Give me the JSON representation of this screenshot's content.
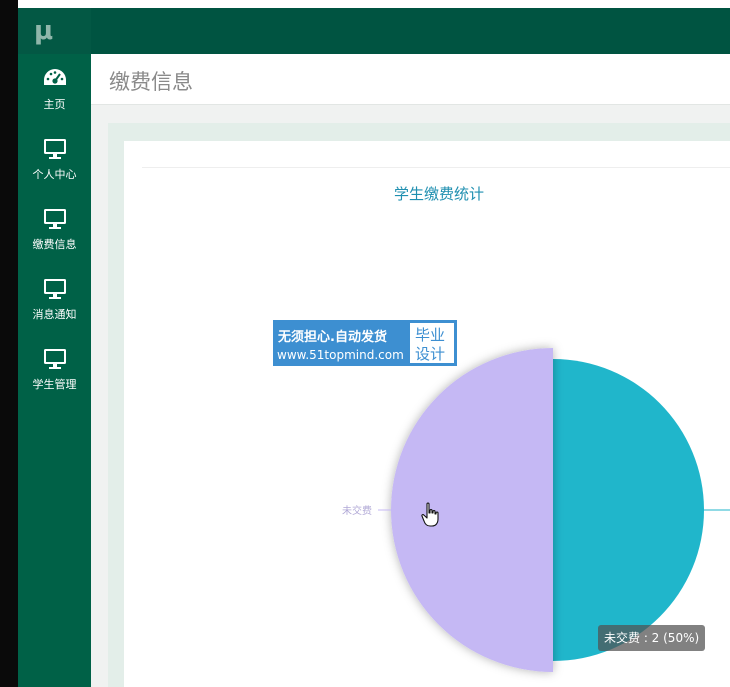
{
  "sidebar": {
    "logo": "μ",
    "items": [
      {
        "label": "主页",
        "icon": "dashboard-icon"
      },
      {
        "label": "个人中心",
        "icon": "monitor-icon"
      },
      {
        "label": "缴费信息",
        "icon": "monitor-icon"
      },
      {
        "label": "消息通知",
        "icon": "monitor-icon"
      },
      {
        "label": "学生管理",
        "icon": "monitor-icon"
      }
    ]
  },
  "header": {
    "page_title": "缴费信息"
  },
  "watermark": {
    "line1": "无须担心.自动发货",
    "line2": "www.51topmind.com",
    "right1": "毕业",
    "right2": "设计"
  },
  "colors": {
    "sidebar": "#006147",
    "topbar": "#005441",
    "slice_unpaid": "#c5b8f4",
    "slice_paid": "#20b6cb",
    "title": "#1f8fb0"
  },
  "chart_data": {
    "type": "pie",
    "title": "学生缴费统计",
    "slices": [
      {
        "name": "未交费",
        "value": 2,
        "percent": 50,
        "color": "#c5b8f4",
        "highlighted": true
      },
      {
        "name": "",
        "value": 2,
        "percent": 50,
        "color": "#20b6cb",
        "highlighted": false
      }
    ],
    "tooltip": "未交费 : 2 (50%)"
  }
}
